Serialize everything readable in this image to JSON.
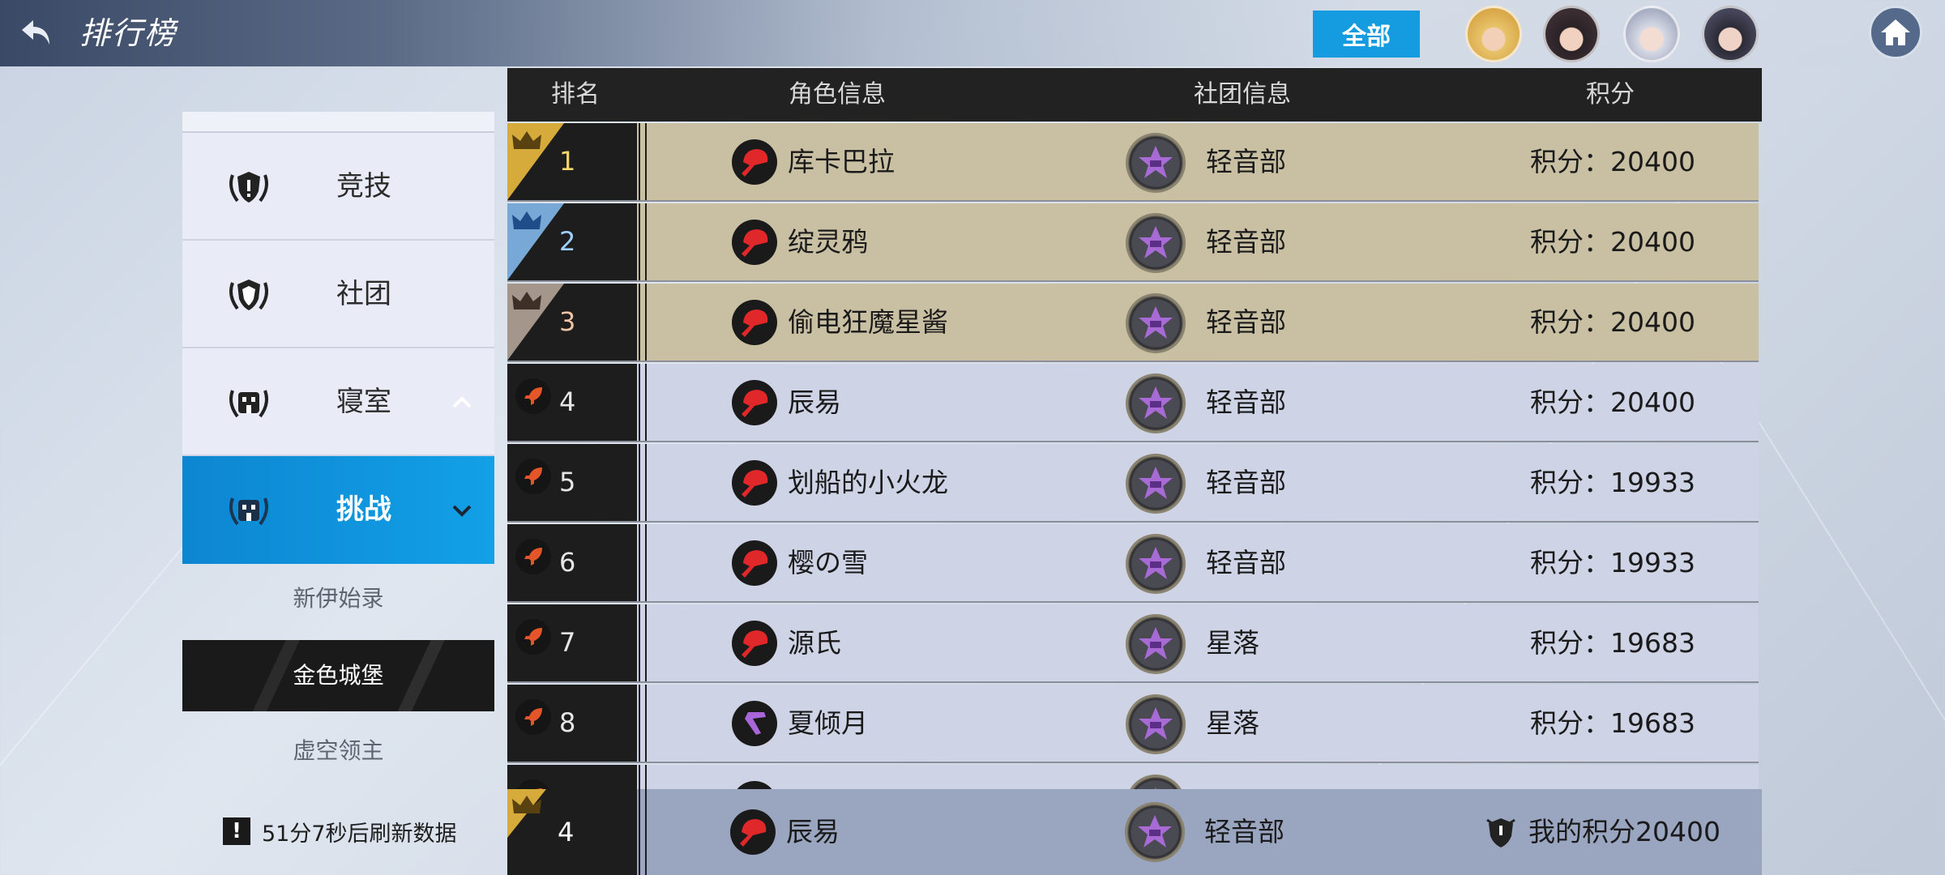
{
  "header": {
    "title": "排行榜",
    "filter_label": "全部",
    "avatars": [
      "avatar-blonde",
      "avatar-black-hair",
      "avatar-silver-hair",
      "avatar-dark-hair"
    ]
  },
  "sidebar": {
    "items": [
      {
        "label": "竞技",
        "icon": "laurel-shield-icon"
      },
      {
        "label": "社团",
        "icon": "laurel-shield-icon"
      },
      {
        "label": "寝室",
        "icon": "laurel-building-icon"
      },
      {
        "label": "挑战",
        "icon": "laurel-building-icon"
      }
    ],
    "subitems": [
      "新伊始录",
      "金色城堡",
      "虚空领主"
    ],
    "refresh_text": "51分7秒后刷新数据",
    "warn_glyph": "!"
  },
  "table": {
    "headers": {
      "rank": "排名",
      "character": "角色信息",
      "guild": "社团信息",
      "score": "积分"
    },
    "rows": [
      {
        "rank": "1",
        "name": "库卡巴拉",
        "guild": "轻音部",
        "score": "积分：20400"
      },
      {
        "rank": "2",
        "name": "绽灵鸦",
        "guild": "轻音部",
        "score": "积分：20400"
      },
      {
        "rank": "3",
        "name": "偷电狂魔星酱",
        "guild": "轻音部",
        "score": "积分：20400"
      },
      {
        "rank": "4",
        "name": "辰易",
        "guild": "轻音部",
        "score": "积分：20400"
      },
      {
        "rank": "5",
        "name": "划船的小火龙",
        "guild": "轻音部",
        "score": "积分：19933"
      },
      {
        "rank": "6",
        "name": "樱の雪",
        "guild": "轻音部",
        "score": "积分：19933"
      },
      {
        "rank": "7",
        "name": "源氏",
        "guild": "星落",
        "score": "积分：19683"
      },
      {
        "rank": "8",
        "name": "夏倾月",
        "guild": "星落",
        "score": "积分：19683"
      }
    ]
  },
  "my_row": {
    "rank": "4",
    "name": "辰易",
    "guild": "轻音部",
    "score": "我的积分20400"
  },
  "colors": {
    "accent": "#159be0",
    "gold": "#d6ab3c",
    "silver": "#78a9d6",
    "bronze": "#a4968a",
    "rocket": "#e4552a"
  }
}
